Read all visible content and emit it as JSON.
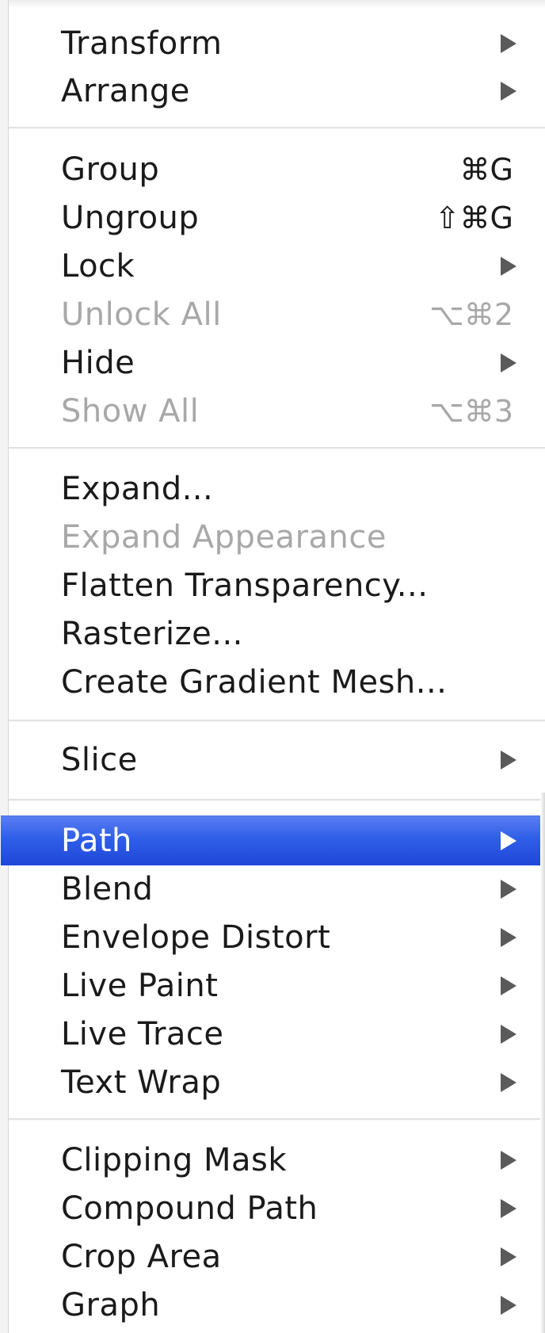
{
  "menu": {
    "groups": [
      {
        "items": [
          {
            "label": "Transform",
            "shortcut": "",
            "submenu": true,
            "disabled": false
          },
          {
            "label": "Arrange",
            "shortcut": "",
            "submenu": true,
            "disabled": false
          }
        ]
      },
      {
        "items": [
          {
            "label": "Group",
            "shortcut": "⌘G",
            "submenu": false,
            "disabled": false
          },
          {
            "label": "Ungroup",
            "shortcut": "⇧⌘G",
            "submenu": false,
            "disabled": false
          },
          {
            "label": "Lock",
            "shortcut": "",
            "submenu": true,
            "disabled": false
          },
          {
            "label": "Unlock All",
            "shortcut": "⌥⌘2",
            "submenu": false,
            "disabled": true
          },
          {
            "label": "Hide",
            "shortcut": "",
            "submenu": true,
            "disabled": false
          },
          {
            "label": "Show All",
            "shortcut": "⌥⌘3",
            "submenu": false,
            "disabled": true
          }
        ]
      },
      {
        "items": [
          {
            "label": "Expand...",
            "shortcut": "",
            "submenu": false,
            "disabled": false
          },
          {
            "label": "Expand Appearance",
            "shortcut": "",
            "submenu": false,
            "disabled": true
          },
          {
            "label": "Flatten Transparency...",
            "shortcut": "",
            "submenu": false,
            "disabled": false
          },
          {
            "label": "Rasterize...",
            "shortcut": "",
            "submenu": false,
            "disabled": false
          },
          {
            "label": "Create Gradient Mesh...",
            "shortcut": "",
            "submenu": false,
            "disabled": false
          }
        ]
      },
      {
        "items": [
          {
            "label": "Slice",
            "shortcut": "",
            "submenu": true,
            "disabled": false
          }
        ]
      },
      {
        "items": [
          {
            "label": "Path",
            "shortcut": "",
            "submenu": true,
            "disabled": false,
            "highlighted": true
          },
          {
            "label": "Blend",
            "shortcut": "",
            "submenu": true,
            "disabled": false
          },
          {
            "label": "Envelope Distort",
            "shortcut": "",
            "submenu": true,
            "disabled": false
          },
          {
            "label": "Live Paint",
            "shortcut": "",
            "submenu": true,
            "disabled": false
          },
          {
            "label": "Live Trace",
            "shortcut": "",
            "submenu": true,
            "disabled": false
          },
          {
            "label": "Text Wrap",
            "shortcut": "",
            "submenu": true,
            "disabled": false
          }
        ]
      },
      {
        "items": [
          {
            "label": "Clipping Mask",
            "shortcut": "",
            "submenu": true,
            "disabled": false
          },
          {
            "label": "Compound Path",
            "shortcut": "",
            "submenu": true,
            "disabled": false
          },
          {
            "label": "Crop Area",
            "shortcut": "",
            "submenu": true,
            "disabled": false
          },
          {
            "label": "Graph",
            "shortcut": "",
            "submenu": true,
            "disabled": false
          }
        ]
      }
    ],
    "colors": {
      "highlight": "#2f5ee8",
      "text": "#1a1a1a",
      "disabled_text": "#a8a8a8"
    }
  }
}
